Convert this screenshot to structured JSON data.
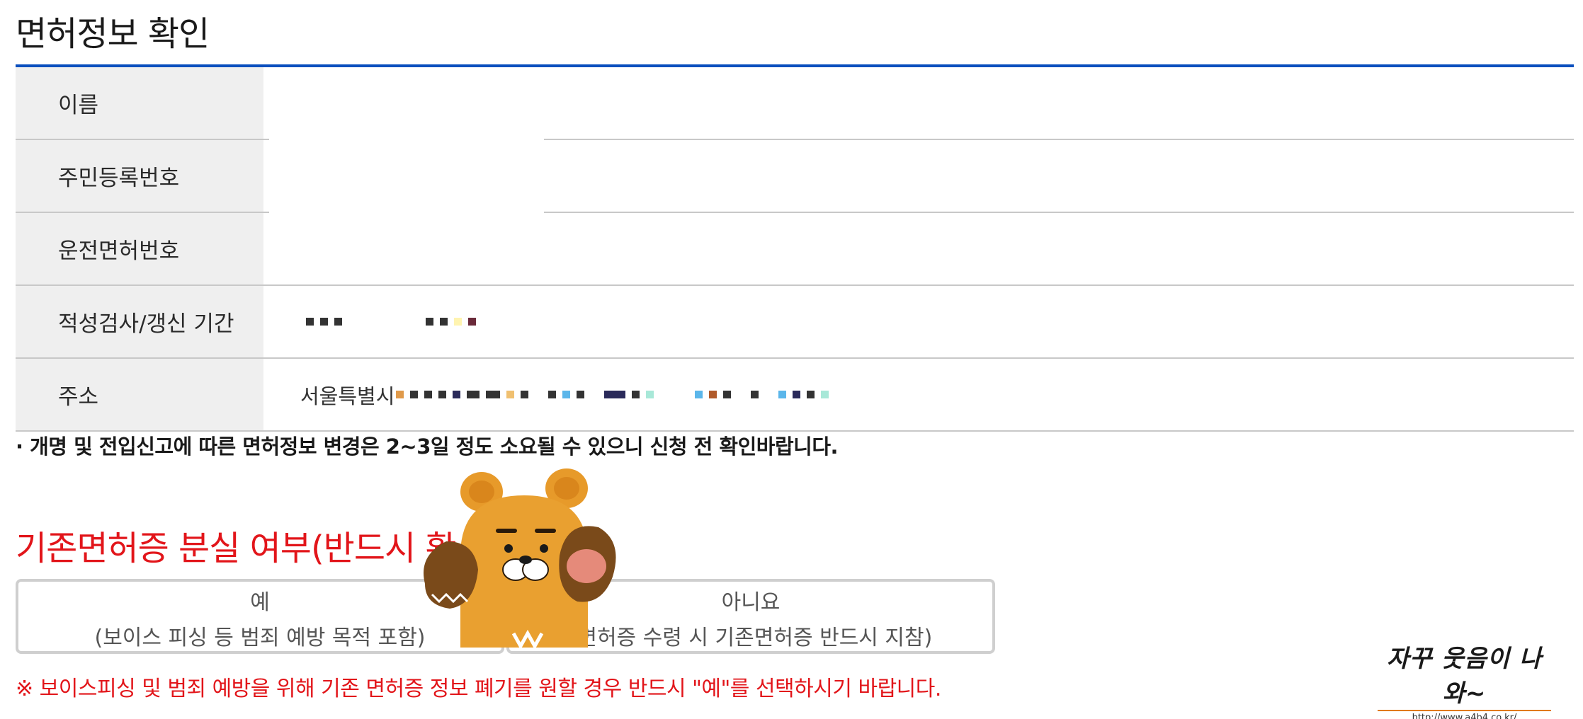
{
  "page": {
    "title": "면허정보 확인",
    "accent_color": "#0a4fbe",
    "warning_color": "#e2151a"
  },
  "info_table": {
    "rows": [
      {
        "label": "이름",
        "value": ""
      },
      {
        "label": "주민등록번호",
        "value": ""
      },
      {
        "label": "운전면허번호",
        "value": ""
      },
      {
        "label": "적성검사/갱신 기간",
        "value": ""
      },
      {
        "label": "주소",
        "value": "서울특별시"
      }
    ]
  },
  "notice": "· 개명 및 전입신고에 따른 면허정보 변경은 2~3일 정도 소요될 수 있으니 신청 전 확인바랍니다.",
  "lost_license": {
    "title": "기존면허증 분실 여부(반드시 확",
    "yes": {
      "label": "예",
      "sub": "(보이스 피싱 등 범죄 예방 목적 포함)"
    },
    "no": {
      "label": "아니요",
      "sub": "(면허증 수령 시 기존면허증 반드시 지참)"
    }
  },
  "warning": "※ 보이스피싱 및 범죄 예방을 위해 기존 면허증 정보 폐기를 원할 경우 반드시 \"예\"를 선택하시기 바랍니다.",
  "watermark": {
    "text": "자꾸 웃음이 나와~",
    "url": "http://www.a4b4.co.kr/"
  }
}
